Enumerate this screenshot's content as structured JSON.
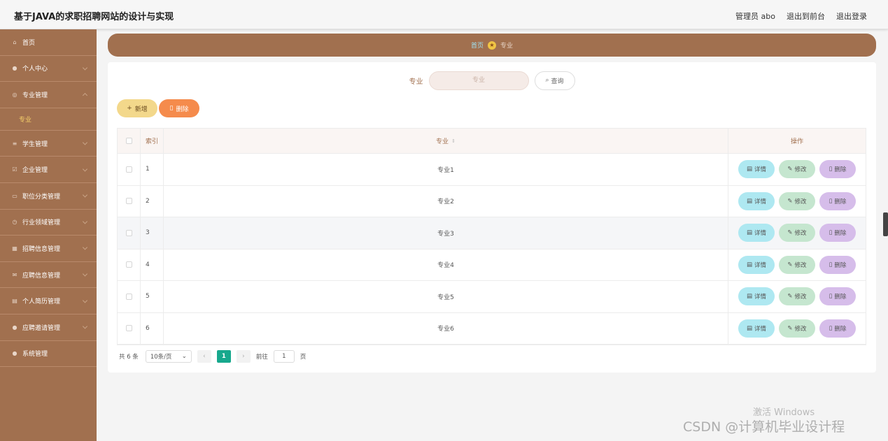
{
  "header": {
    "title": "基于JAVA的求职招聘网站的设计与实现",
    "user": "管理员 abo",
    "to_front": "退出到前台",
    "logout": "退出登录"
  },
  "sidebar": {
    "items": [
      {
        "label": "首页",
        "icon": "home-icon"
      },
      {
        "label": "个人中心",
        "icon": "user-icon"
      },
      {
        "label": "专业管理",
        "icon": "circle-icon",
        "sub": "专业"
      },
      {
        "label": "学生管理",
        "icon": "sliders-icon"
      },
      {
        "label": "企业管理",
        "icon": "checkbox-icon"
      },
      {
        "label": "职位分类管理",
        "icon": "doc-icon"
      },
      {
        "label": "行业领域管理",
        "icon": "clock-icon"
      },
      {
        "label": "招聘信息管理",
        "icon": "bank-icon"
      },
      {
        "label": "应聘信息管理",
        "icon": "mail-icon"
      },
      {
        "label": "个人简历管理",
        "icon": "card-icon"
      },
      {
        "label": "应聘邀请管理",
        "icon": "pin-icon"
      },
      {
        "label": "系统管理",
        "icon": "user-icon"
      }
    ]
  },
  "breadcrumb": {
    "home": "首页",
    "current": "专业"
  },
  "search": {
    "label": "专业",
    "placeholder": "专业",
    "button": "查询"
  },
  "actions": {
    "add": "新增",
    "delete": "删除"
  },
  "table": {
    "headers": {
      "index": "索引",
      "major": "专业",
      "ops": "操作"
    },
    "rows": [
      {
        "index": "1",
        "major": "专业1"
      },
      {
        "index": "2",
        "major": "专业2"
      },
      {
        "index": "3",
        "major": "专业3"
      },
      {
        "index": "4",
        "major": "专业4"
      },
      {
        "index": "5",
        "major": "专业5"
      },
      {
        "index": "6",
        "major": "专业6"
      }
    ],
    "btn_detail": "详情",
    "btn_edit": "修改",
    "btn_delete": "删除"
  },
  "pager": {
    "total": "共 6 条",
    "page_size": "10条/页",
    "current": "1",
    "goto_prefix": "前往",
    "goto_value": "1",
    "goto_suffix": "页"
  },
  "watermark": {
    "line1": "激活 Windows",
    "line2": "CSDN @计算机毕业设计程"
  },
  "colors": {
    "sidebar": "#a1704f",
    "accent": "#17a88d",
    "add": "#f3d88b",
    "delete": "#f58b4c"
  }
}
